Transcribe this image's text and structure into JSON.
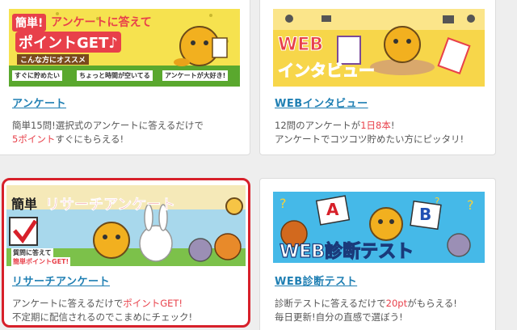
{
  "cards": [
    {
      "title": "アンケート",
      "banner": {
        "tag": "簡単!",
        "line1": "アンケートに答えて",
        "line2": "ポイントGET♪",
        "sub": "こんな方にオススメ",
        "checks": [
          "すぐに貯めたい",
          "ちょっと時間が空いてる",
          "アンケートが大好き!"
        ]
      },
      "desc": {
        "l1": "簡単15問!選択式のアンケートに答えるだけで",
        "l2a": "5ポイント",
        "l2b": "すぐにもらえる!"
      }
    },
    {
      "title": "WEBインタビュー",
      "banner": {
        "line1": "WEB",
        "line2": "インタビュー"
      },
      "desc": {
        "l1a": "12問のアンケートが",
        "l1b": "1日8本",
        "l1c": "!",
        "l2": "アンケートでコツコツ貯めたい方にピッタリ!"
      }
    },
    {
      "title": "リサーチアンケート",
      "banner": {
        "tag": "簡単",
        "line1": "リサーチアンケート",
        "note1": "質問に答えて",
        "note2": "簡単ポイントGET!"
      },
      "desc": {
        "l1a": "アンケートに答えるだけで",
        "l1b": "ポイントGET!",
        "l2": "不定期に配信されるのでこまめにチェック!"
      }
    },
    {
      "title": "WEB診断テスト",
      "banner": {
        "line1": "WEB診断テスト",
        "cardA": "A",
        "cardB": "B"
      },
      "desc": {
        "l1a": "診断テストに答えるだけで",
        "l1b": "20pt",
        "l1c": "がもらえる!",
        "l2": "毎日更新!自分の直感で選ぼう!"
      }
    }
  ],
  "colors": {
    "link": "#1f7fb3",
    "accent_red": "#e8404a",
    "selected_border": "#d7202a"
  }
}
